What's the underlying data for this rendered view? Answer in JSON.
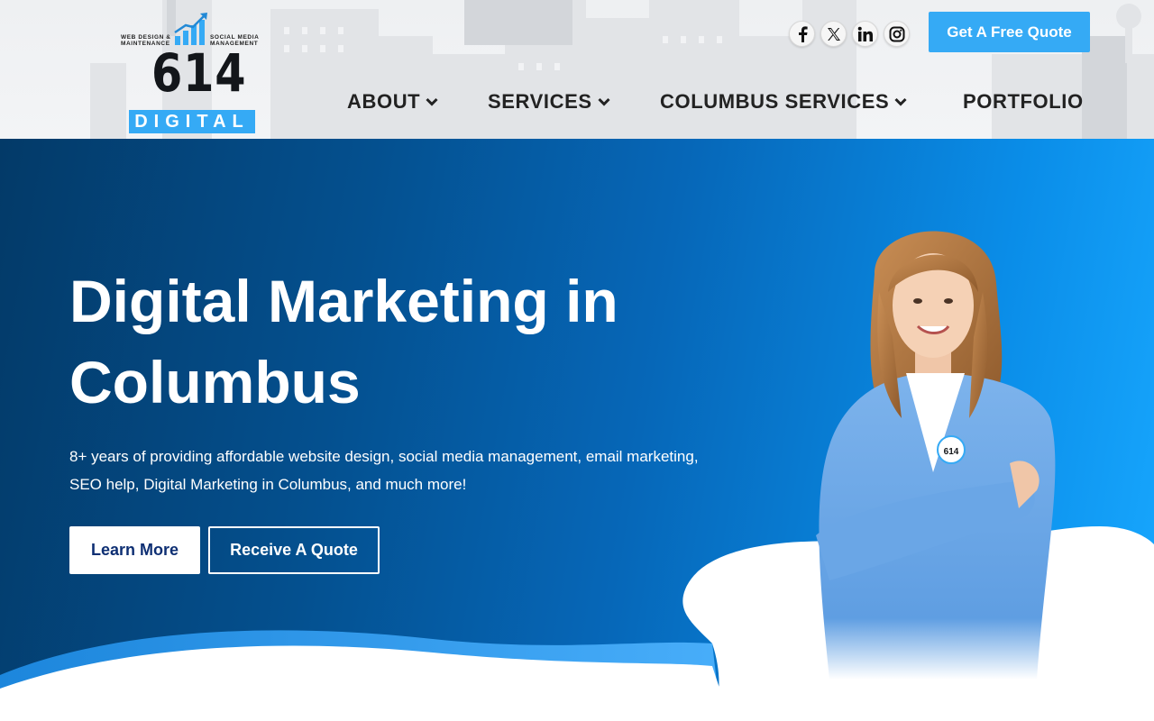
{
  "brand": {
    "logo_number": "614",
    "logo_word": "DIGITAL",
    "tagline_left_1": "WEB DESIGN &",
    "tagline_left_2": "MAINTENANCE",
    "tagline_right_1": "SOCIAL MEDIA",
    "tagline_right_2": "MANAGEMENT",
    "accent_color": "#35aaf5"
  },
  "header": {
    "social": [
      {
        "icon": "facebook-icon"
      },
      {
        "icon": "x-icon"
      },
      {
        "icon": "linkedin-icon"
      },
      {
        "icon": "instagram-icon"
      }
    ],
    "cta_label": "Get A Free Quote",
    "nav": [
      {
        "label": "ABOUT",
        "has_dropdown": true
      },
      {
        "label": "SERVICES",
        "has_dropdown": true
      },
      {
        "label": "COLUMBUS SERVICES",
        "has_dropdown": true
      },
      {
        "label": "PORTFOLIO",
        "has_dropdown": false
      }
    ]
  },
  "hero": {
    "title_line1": "Digital Marketing in",
    "title_line2": "Columbus",
    "subtitle_line1": "8+ years of providing affordable website design, social media management, email marketing,",
    "subtitle_line2": "SEO help, Digital Marketing in Columbus, and much more!",
    "primary_button": "Learn More",
    "secondary_button": "Receive A Quote",
    "badge_text": "614",
    "colors": {
      "dark": "#033a68",
      "mid": "#0667b8",
      "light": "#18a8ff",
      "blazer": "#6ea8e6"
    }
  }
}
